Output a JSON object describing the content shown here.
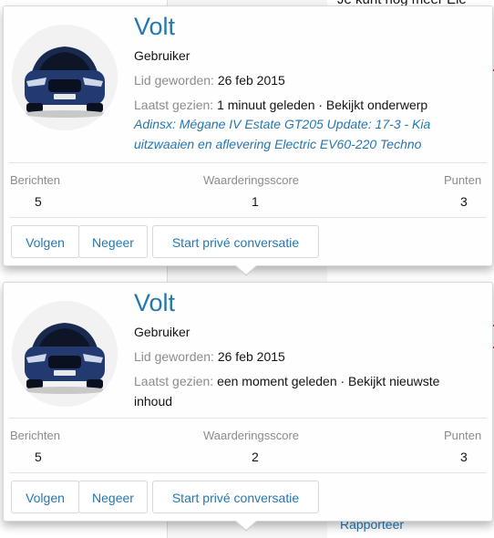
{
  "background": {
    "top_text": "Je kunt nog meer Ele",
    "report_link": "Rapporteer"
  },
  "cards": [
    {
      "username": "Volt",
      "role": "Gebruiker",
      "joined_label": "Lid geworden:",
      "joined_value": "26 feb 2015",
      "last_seen_label": "Laatst gezien:",
      "last_seen_value": "1 minuut geleden · Bekijkt onderwerp",
      "activity_link": "Adinsx: Mégane IV Estate GT205 Update: 17-3 - Kia uitzwaaien en aflevering Electric EV60-220 Techno",
      "stats": [
        {
          "label": "Berichten",
          "value": "5"
        },
        {
          "label": "Waarderingsscore",
          "value": "1"
        },
        {
          "label": "Punten",
          "value": "3"
        }
      ],
      "buttons": {
        "follow": "Volgen",
        "ignore": "Negeer",
        "message": "Start privé conversatie"
      }
    },
    {
      "username": "Volt",
      "role": "Gebruiker",
      "joined_label": "Lid geworden:",
      "joined_value": "26 feb 2015",
      "last_seen_label": "Laatst gezien:",
      "last_seen_value": "een moment geleden · Bekijkt nieuwste",
      "last_seen_value_2": "inhoud",
      "stats": [
        {
          "label": "Berichten",
          "value": "5"
        },
        {
          "label": "Waarderingsscore",
          "value": "2"
        },
        {
          "label": "Punten",
          "value": "3"
        }
      ],
      "buttons": {
        "follow": "Volgen",
        "ignore": "Negeer",
        "message": "Start privé conversatie"
      }
    }
  ],
  "colors": {
    "link": "#2577b1",
    "muted": "#8c8c8c",
    "text": "#141414"
  }
}
